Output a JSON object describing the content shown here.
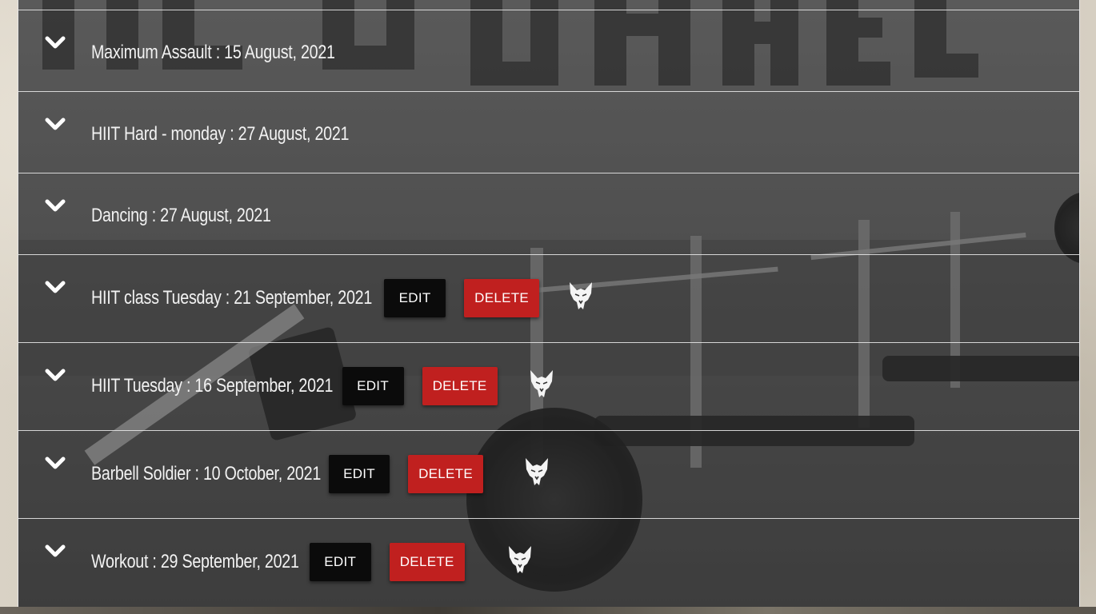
{
  "rows": [
    {
      "title": "Maximum Assault : 15 August, 2021",
      "has_actions": false
    },
    {
      "title": "HIIT Hard - monday : 27 August, 2021",
      "has_actions": false
    },
    {
      "title": "Dancing : 27 August, 2021",
      "has_actions": false
    },
    {
      "title": "HIIT class Tuesday : 21 September, 2021",
      "has_actions": true,
      "edit_label": "EDIT",
      "delete_label": "DELETE"
    },
    {
      "title": "HIIT Tuesday : 16 September, 2021",
      "has_actions": true,
      "edit_label": "EDIT",
      "delete_label": "DELETE"
    },
    {
      "title": "Barbell Soldier : 10 October, 2021",
      "has_actions": true,
      "edit_label": "EDIT",
      "delete_label": "DELETE"
    },
    {
      "title": "Workout : 29 September, 2021",
      "has_actions": true,
      "edit_label": "EDIT",
      "delete_label": "DELETE"
    }
  ],
  "icons": {
    "expand": "chevron-down-icon",
    "brand": "wolf-logo-icon"
  },
  "colors": {
    "edit_button": "#0b0b0b",
    "delete_button": "#c0201f",
    "text": "#f2f2f2"
  }
}
